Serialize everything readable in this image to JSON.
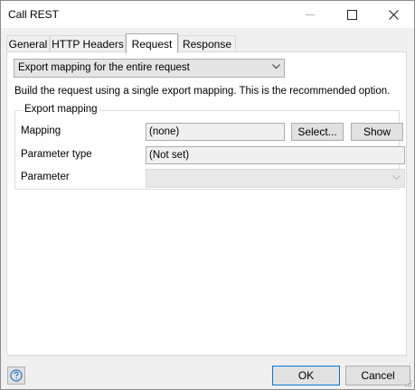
{
  "window": {
    "title": "Call REST"
  },
  "tabs": [
    {
      "label": "General"
    },
    {
      "label": "HTTP Headers"
    },
    {
      "label": "Request"
    },
    {
      "label": "Response"
    }
  ],
  "request": {
    "mode_selected": "Export mapping for the entire request",
    "description": "Build the request using a single export mapping. This is the recommended option.",
    "group_title": "Export mapping",
    "mapping_label": "Mapping",
    "mapping_value": "(none)",
    "select_button": "Select...",
    "show_button": "Show",
    "parameter_type_label": "Parameter type",
    "parameter_type_value": "(Not set)",
    "parameter_label": "Parameter",
    "parameter_value": ""
  },
  "footer": {
    "ok_label": "OK",
    "cancel_label": "Cancel"
  },
  "colors": {
    "accent": "#0078d7",
    "help_icon": "#1e78c8"
  }
}
